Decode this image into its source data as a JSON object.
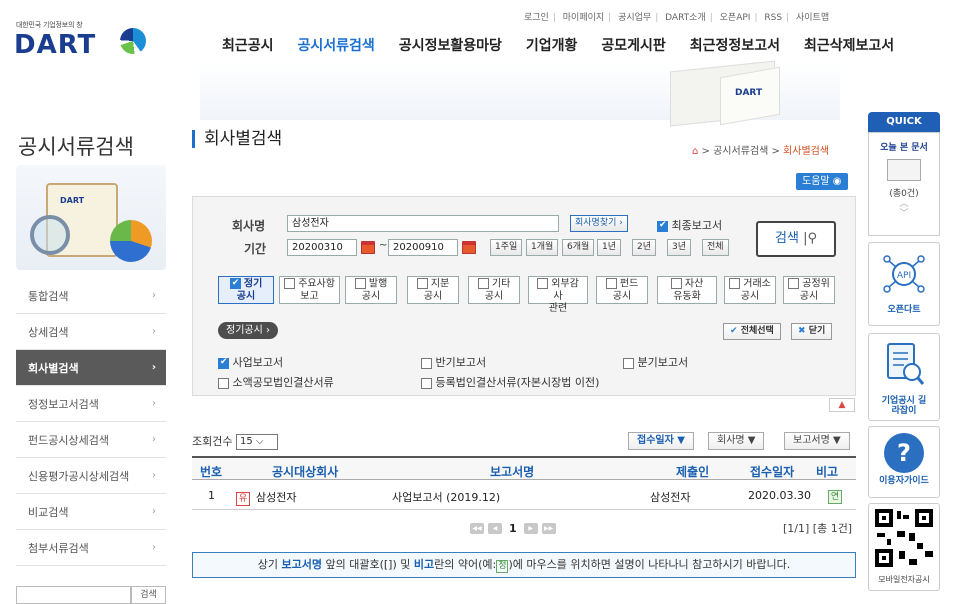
{
  "util_links": [
    "로그인",
    "마이페이지",
    "공시업무",
    "DART소개",
    "오픈API",
    "RSS",
    "사이트맵"
  ],
  "logo": {
    "subtitle": "대한민국 기업정보의 창",
    "name": "DART"
  },
  "gnb": [
    "최근공시",
    "공시서류검색",
    "공시정보활용마당",
    "기업개황",
    "공모게시판",
    "최근정정보고서",
    "최근삭제보고서"
  ],
  "gnb_active": "공시서류검색",
  "banner": {
    "book_brand": "DART"
  },
  "sidebar": {
    "title": "공시서류검색",
    "illustration": {
      "clipboard_brand": "DART"
    },
    "items": [
      {
        "label": "통합검색",
        "arrow": "›"
      },
      {
        "label": "상세검색",
        "arrow": "›"
      },
      {
        "label": "회사별검색",
        "arrow": "›",
        "active": true
      },
      {
        "label": "정정보고서검색",
        "arrow": "›"
      },
      {
        "label": "펀드공시상세검색",
        "arrow": "›"
      },
      {
        "label": "신용평가공시상세검색",
        "arrow": "›"
      },
      {
        "label": "비교검색",
        "arrow": "›"
      },
      {
        "label": "첨부서류검색",
        "arrow": "›"
      }
    ],
    "search_button": "검색"
  },
  "content": {
    "title": "회사별검색",
    "breadcrumb": [
      " > 공시서류검색 > ",
      "회사별검색"
    ],
    "help_label": "도움말"
  },
  "search": {
    "company_label": "회사명",
    "company_value": "삼성전자",
    "find_company_btn": "회사명찾기 ›",
    "latest_report_label": "최종보고서",
    "latest_report_checked": true,
    "period_label": "기간",
    "date_from": "20200310",
    "date_sep": "~",
    "date_to": "20200910",
    "period_buttons": [
      "1주일",
      "1개월",
      "6개월",
      "1년",
      "2년",
      "3년",
      "전체"
    ],
    "search_btn": "검색",
    "kinds": [
      {
        "l1": "정기",
        "l2": "공시",
        "checked": true
      },
      {
        "l1": "주요사항",
        "l2": "보고",
        "checked": false
      },
      {
        "l1": "발행",
        "l2": "공시",
        "checked": false
      },
      {
        "l1": "지분",
        "l2": "공시",
        "checked": false
      },
      {
        "l1": "기타",
        "l2": "공시",
        "checked": false
      },
      {
        "l1": "외부감사",
        "l2": "관련",
        "checked": false
      },
      {
        "l1": "펀드",
        "l2": "공시",
        "checked": false
      },
      {
        "l1": "자산",
        "l2": "유동화",
        "checked": false
      },
      {
        "l1": "거래소",
        "l2": "공시",
        "checked": false
      },
      {
        "l1": "공정위",
        "l2": "공시",
        "checked": false
      }
    ],
    "category_badge": "정기공시 ›",
    "select_all": "전체선택",
    "close": "닫기",
    "reports": [
      {
        "label": "사업보고서",
        "checked": true
      },
      {
        "label": "반기보고서",
        "checked": false
      },
      {
        "label": "분기보고서",
        "checked": false
      },
      {
        "label": "소액공모법인결산서류",
        "checked": false
      },
      {
        "label": "등록법인결산서류(자본시장법 이전)",
        "checked": false
      }
    ]
  },
  "results": {
    "count_label": "조회건수",
    "count_value": "15",
    "sort_buttons": [
      "접수일자 ▼",
      "회사명 ▼",
      "보고서명 ▼"
    ],
    "headers": [
      "번호",
      "공시대상회사",
      "보고서명",
      "제출인",
      "접수일자",
      "비고"
    ],
    "rows": [
      {
        "no": "1",
        "market": "유",
        "company": "삼성전자",
        "report": "사업보고서 (2019.12)",
        "filer": "삼성전자",
        "date": "2020.03.30",
        "note": "연"
      }
    ],
    "current_page": "1",
    "page_info": "[1/1] [총 1건]"
  },
  "info_text": {
    "pre": "상기 ",
    "b1": "보고서명",
    "mid": " 앞의 대괄호([]) 및 ",
    "b2": "비고",
    "mid2": "란의 약어(예:",
    "ex": "정",
    "post": ")에 마우스를 위치하면 설명이 나타나니 참고하시기 바랍니다."
  },
  "quick": {
    "header": "QUICK",
    "today_title": "오늘 본 문서",
    "today_count": "(총0건)",
    "items": [
      "오픈다트",
      "기업공시 길라잡이",
      "이용자가이드",
      "모바일전자공시"
    ]
  }
}
